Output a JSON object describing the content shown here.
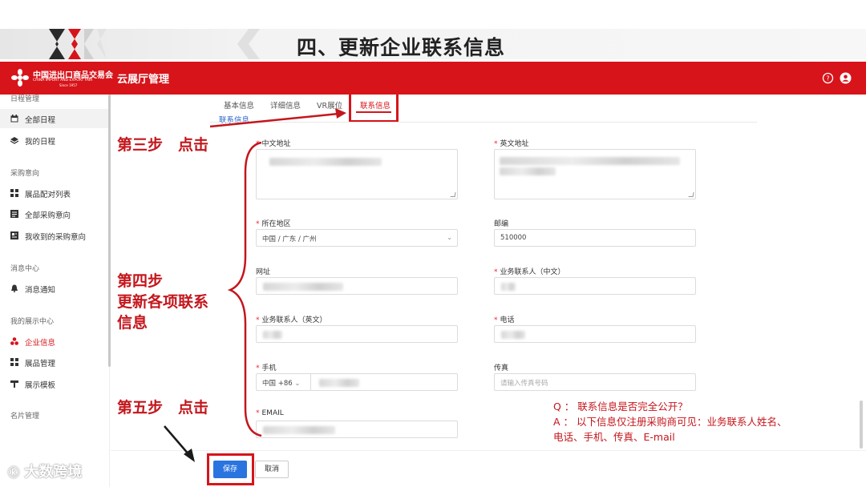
{
  "slide": {
    "title": "四、更新企业联系信息"
  },
  "header": {
    "logo_cn": "中国进出口商品交易会",
    "logo_en": "CHINA IMPORT AND EXPORT FAIR",
    "logo_since": "Since 1957",
    "app_title": "云展厅管理",
    "help_icon": "help-circle-icon",
    "user_icon": "user-icon",
    "brand_color": "#d7141a"
  },
  "sidebar": {
    "sections": [
      {
        "title": "日程管理",
        "items": [
          {
            "label": "全部日程",
            "icon": "calendar-icon"
          },
          {
            "label": "我的日程",
            "icon": "layers-icon"
          }
        ]
      },
      {
        "title": "采购意向",
        "items": [
          {
            "label": "展品配对列表",
            "icon": "grid-icon"
          },
          {
            "label": "全部采购意向",
            "icon": "list-icon"
          },
          {
            "label": "我收到的采购意向",
            "icon": "inbox-icon"
          }
        ]
      },
      {
        "title": "消息中心",
        "items": [
          {
            "label": "消息通知",
            "icon": "bell-icon"
          }
        ]
      },
      {
        "title": "我的展示中心",
        "items": [
          {
            "label": "企业信息",
            "icon": "org-icon"
          },
          {
            "label": "展品管理",
            "icon": "grid-icon"
          },
          {
            "label": "展示模板",
            "icon": "template-icon"
          }
        ]
      },
      {
        "title": "名片管理",
        "items": []
      }
    ]
  },
  "tabs": [
    "基本信息",
    "详细信息",
    "VR展位",
    "联系信息"
  ],
  "section_title": "联系信息",
  "form": {
    "cn_address": {
      "label": "中文地址",
      "required": true
    },
    "en_address": {
      "label": "英文地址",
      "required": true
    },
    "region": {
      "label": "所在地区",
      "required": true,
      "value": "中国 / 广东 / 广州"
    },
    "postcode": {
      "label": "邮编",
      "required": false,
      "value": "510000"
    },
    "website": {
      "label": "网址",
      "required": false
    },
    "contact_cn": {
      "label": "业务联系人（中文）",
      "required": true
    },
    "contact_en": {
      "label": "业务联系人（英文）",
      "required": true
    },
    "phone": {
      "label": "电话",
      "required": true
    },
    "mobile": {
      "label": "手机",
      "required": true,
      "country_code": "中国 +86"
    },
    "fax": {
      "label": "传真",
      "required": false,
      "placeholder": "请输入传真号码"
    },
    "email": {
      "label": "EMAIL",
      "required": true
    }
  },
  "buttons": {
    "save": "保存",
    "cancel": "取消"
  },
  "annotations": {
    "step3": "第三步　点击",
    "step4_line1": "第四步",
    "step4_line2": "更新各项联系",
    "step4_line3": "信息",
    "step5": "第五步　点击",
    "q": "Q ： 联系信息是否完全公开？",
    "a_line1": "A ： 以下信息仅注册采购商可见：业务联系人姓名、",
    "a_line2": "电话、手机、传真、E-mail"
  },
  "watermark": "大数跨境"
}
